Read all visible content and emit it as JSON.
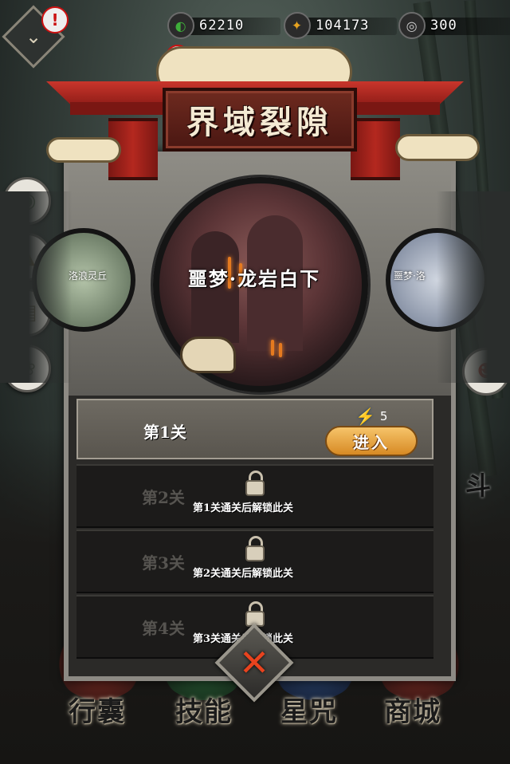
{
  "currencies": [
    {
      "name": "jade",
      "icon": "green-jade-icon",
      "value": "62210",
      "color": "#3fae3a"
    },
    {
      "name": "coin",
      "icon": "gold-coin-icon",
      "value": "104173",
      "color": "#e5a21f"
    },
    {
      "name": "spirit",
      "icon": "silver-swirl-icon",
      "value": "300",
      "color": "#cfcfcf"
    }
  ],
  "alerts": {
    "top_left": "!",
    "top_center": "!"
  },
  "panel": {
    "title": "界域裂隙",
    "stages": {
      "left": "洛浪灵丘",
      "center": "噩梦·龙岩白下",
      "right": "噩梦·洛"
    }
  },
  "levels": [
    {
      "label": "第1关",
      "locked": false,
      "energy": "5",
      "enter_label": "进入"
    },
    {
      "label": "第2关",
      "locked": true,
      "unlock_hint": "第1关通关后解锁此关"
    },
    {
      "label": "第3关",
      "locked": true,
      "unlock_hint": "第2关通关后解锁此关"
    },
    {
      "label": "第4关",
      "locked": true,
      "unlock_hint": "第3关通关后解锁此关"
    }
  ],
  "bottom_nav": [
    "行囊",
    "技能",
    "星咒",
    "商城"
  ],
  "right_side_label": "斗",
  "close_label": "✕"
}
